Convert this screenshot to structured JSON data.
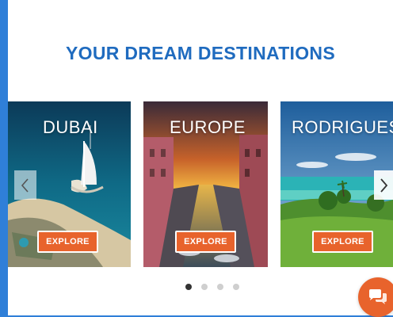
{
  "heading": "YOUR DREAM DESTINATIONS",
  "slides": [
    {
      "title": "DUBAI",
      "button": "EXPLORE"
    },
    {
      "title": "EUROPE",
      "button": "EXPLORE"
    },
    {
      "title": "RODRIGUES",
      "button": "EXPLORE"
    }
  ],
  "pagination": {
    "count": 4,
    "active": 1
  },
  "icons": {
    "prev": "chevron-left-icon",
    "next": "chevron-right-icon",
    "chat": "chat-bubbles-icon"
  },
  "colors": {
    "page_background": "#2f7fd8",
    "heading": "#1f6bbf",
    "accent": "#e8632c"
  }
}
